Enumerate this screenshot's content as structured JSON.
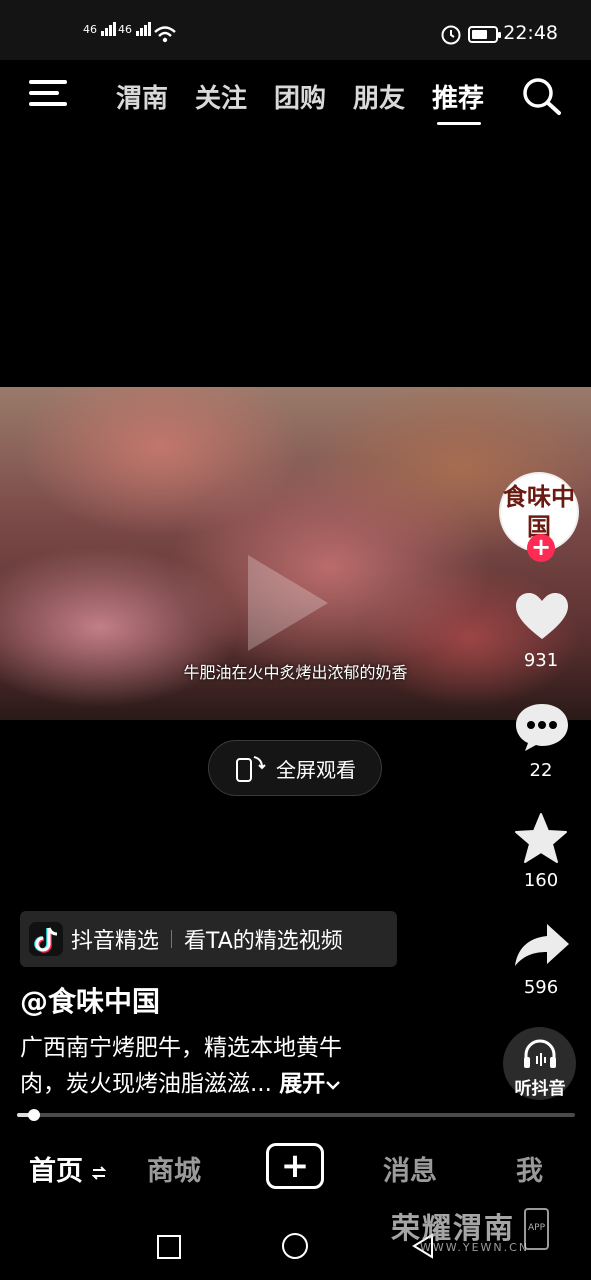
{
  "status": {
    "sim1": "46",
    "sim2": "46",
    "time": "22:48"
  },
  "nav": {
    "tabs": [
      "渭南",
      "关注",
      "团购",
      "朋友",
      "推荐"
    ],
    "active": "推荐"
  },
  "video": {
    "caption": "牛肥油在火中炙烤出浓郁的奶香",
    "fullscreen_label": "全屏观看"
  },
  "rail": {
    "avatar_text": "食味中国",
    "likes": "931",
    "comments": "22",
    "favorites": "160",
    "shares": "596",
    "listen_label": "听抖音"
  },
  "post": {
    "badge_brand": "抖音精选",
    "badge_action": "看TA的精选视频",
    "author": "@食味中国",
    "description_line1": "广西南宁烤肥牛，精选本地黄牛",
    "description_line2": "肉，炭火现烤油脂滋滋...",
    "expand_label": "展开"
  },
  "progress": {
    "fraction": 0.03
  },
  "bottom_tabs": {
    "home": "首页",
    "mall": "商城",
    "messages": "消息",
    "me": "我"
  },
  "watermark": {
    "title": "荣耀渭南",
    "url": "WWW.YEWN.CN",
    "app": "APP"
  }
}
